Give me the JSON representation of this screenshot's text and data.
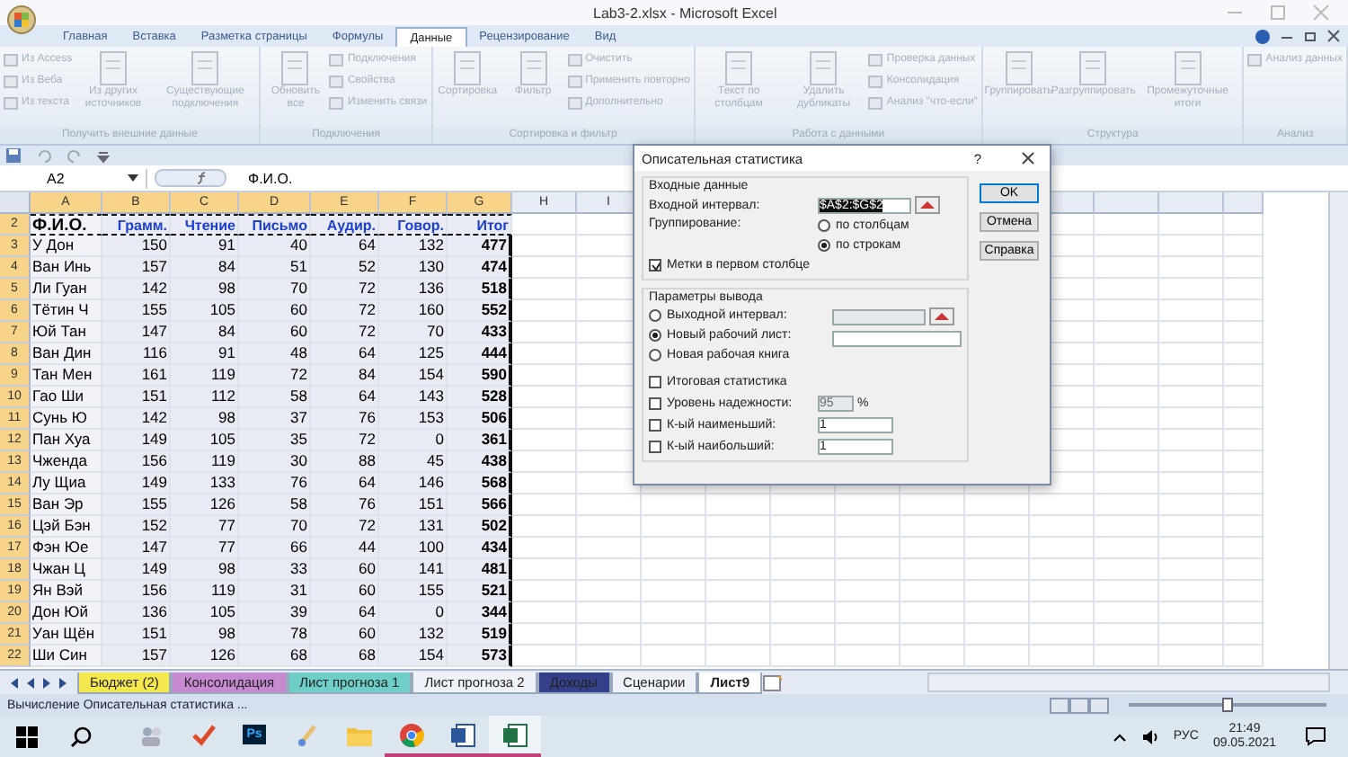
{
  "window": {
    "title": "Lab3-2.xlsx - Microsoft Excel"
  },
  "ribbon": {
    "tabs": [
      {
        "label": "Главная",
        "selected": false
      },
      {
        "label": "Вставка",
        "selected": false
      },
      {
        "label": "Разметка страницы",
        "selected": false
      },
      {
        "label": "Формулы",
        "selected": false
      },
      {
        "label": "Данные",
        "selected": true
      },
      {
        "label": "Рецензирование",
        "selected": false
      },
      {
        "label": "Вид",
        "selected": false
      }
    ],
    "groups": [
      {
        "label": "Получить внешние данные",
        "items": [
          {
            "kind": "stack",
            "entries": [
              "Из Access",
              "Из Веба",
              "Из текста"
            ]
          },
          {
            "kind": "large",
            "label": "Из других источников"
          },
          {
            "kind": "large",
            "label": "Существующие подключения"
          }
        ]
      },
      {
        "label": "Подключения",
        "items": [
          {
            "kind": "large",
            "label": "Обновить все"
          },
          {
            "kind": "stack",
            "entries": [
              "Подключения",
              "Свойства",
              "Изменить связи"
            ]
          }
        ]
      },
      {
        "label": "Сортировка и фильтр",
        "items": [
          {
            "kind": "large",
            "label": "Сортировка"
          },
          {
            "kind": "large",
            "label": "Фильтр"
          },
          {
            "kind": "stack",
            "entries": [
              "Очистить",
              "Применить повторно",
              "Дополнительно"
            ]
          }
        ]
      },
      {
        "label": "Работа с данными",
        "items": [
          {
            "kind": "large",
            "label": "Текст по столбцам"
          },
          {
            "kind": "large",
            "label": "Удалить дубликаты"
          },
          {
            "kind": "stack",
            "entries": [
              "Проверка данных",
              "Консолидация",
              "Анализ \"что-если\""
            ]
          }
        ]
      },
      {
        "label": "Структура",
        "items": [
          {
            "kind": "large",
            "label": "Группировать"
          },
          {
            "kind": "large",
            "label": "Разгруппировать"
          },
          {
            "kind": "large",
            "label": "Промежуточные итоги"
          }
        ]
      },
      {
        "label": "Анализ",
        "items": [
          {
            "kind": "stack",
            "entries": [
              "Анализ данных"
            ]
          }
        ]
      }
    ]
  },
  "formula_bar": {
    "name_box": "A2",
    "formula": "Ф.И.О."
  },
  "sheet": {
    "columns": [
      "A",
      "B",
      "C",
      "D",
      "E",
      "F",
      "G",
      "H",
      "I"
    ],
    "header_row": {
      "number": "2",
      "cells": [
        "Ф.И.О.",
        "Грамм.",
        "Чтение",
        "Письмо",
        "Аудир.",
        "Говор.",
        "Итог"
      ]
    },
    "rows": [
      {
        "number": "3",
        "name": "У Дон",
        "values": [
          "150",
          "91",
          "40",
          "64",
          "132"
        ],
        "total": "477"
      },
      {
        "number": "4",
        "name": "Ван Инь",
        "values": [
          "157",
          "84",
          "51",
          "52",
          "130"
        ],
        "total": "474"
      },
      {
        "number": "5",
        "name": "Ли Гуан",
        "values": [
          "142",
          "98",
          "70",
          "72",
          "136"
        ],
        "total": "518"
      },
      {
        "number": "6",
        "name": "Тётин Ч",
        "values": [
          "155",
          "105",
          "60",
          "72",
          "160"
        ],
        "total": "552"
      },
      {
        "number": "7",
        "name": "Юй Тан",
        "values": [
          "147",
          "84",
          "60",
          "72",
          "70"
        ],
        "total": "433"
      },
      {
        "number": "8",
        "name": "Ван Дин",
        "values": [
          "116",
          "91",
          "48",
          "64",
          "125"
        ],
        "total": "444"
      },
      {
        "number": "9",
        "name": "Тан Мен",
        "values": [
          "161",
          "119",
          "72",
          "84",
          "154"
        ],
        "total": "590"
      },
      {
        "number": "10",
        "name": "Гао Ши",
        "values": [
          "151",
          "112",
          "58",
          "64",
          "143"
        ],
        "total": "528"
      },
      {
        "number": "11",
        "name": "Сунь Ю",
        "values": [
          "142",
          "98",
          "37",
          "76",
          "153"
        ],
        "total": "506"
      },
      {
        "number": "12",
        "name": "Пан Хуа",
        "values": [
          "149",
          "105",
          "35",
          "72",
          "0"
        ],
        "total": "361"
      },
      {
        "number": "13",
        "name": "Чженда",
        "values": [
          "156",
          "119",
          "30",
          "88",
          "45"
        ],
        "total": "438"
      },
      {
        "number": "14",
        "name": "Лу Щиа",
        "values": [
          "149",
          "133",
          "76",
          "64",
          "146"
        ],
        "total": "568"
      },
      {
        "number": "15",
        "name": "Ван Эр",
        "values": [
          "155",
          "126",
          "58",
          "76",
          "151"
        ],
        "total": "566"
      },
      {
        "number": "16",
        "name": "Цэй Бэн",
        "values": [
          "152",
          "77",
          "70",
          "72",
          "131"
        ],
        "total": "502"
      },
      {
        "number": "17",
        "name": "Фэн Юе",
        "values": [
          "147",
          "77",
          "66",
          "44",
          "100"
        ],
        "total": "434"
      },
      {
        "number": "18",
        "name": "Чжан Ц",
        "values": [
          "149",
          "98",
          "33",
          "60",
          "141"
        ],
        "total": "481"
      },
      {
        "number": "19",
        "name": "Ян Вэй",
        "values": [
          "156",
          "119",
          "31",
          "60",
          "155"
        ],
        "total": "521"
      },
      {
        "number": "20",
        "name": "Дон Юй",
        "values": [
          "136",
          "105",
          "39",
          "64",
          "0"
        ],
        "total": "344"
      },
      {
        "number": "21",
        "name": "Уан Щён",
        "values": [
          "151",
          "98",
          "78",
          "60",
          "132"
        ],
        "total": "519"
      },
      {
        "number": "22",
        "name": "Ши Син",
        "values": [
          "157",
          "126",
          "68",
          "68",
          "154"
        ],
        "total": "573"
      }
    ]
  },
  "dialog": {
    "title": "Описательная статистика",
    "help": "?",
    "input_section": "Входные данные",
    "input_range_label": "Входной интервал:",
    "input_range": "$A$2:$G$2",
    "grouping_label": "Группирование:",
    "grouping": [
      {
        "label": "по столбцам",
        "selected": false
      },
      {
        "label": "по строкам",
        "selected": true
      }
    ],
    "labels_checkbox": {
      "label": "Метки в первом столбце",
      "checked": true
    },
    "output_section": "Параметры вывода",
    "output": [
      {
        "label": "Выходной интервал:",
        "selected": false,
        "kind": "range"
      },
      {
        "label": "Новый рабочий лист:",
        "selected": true,
        "kind": "text"
      },
      {
        "label": "Новая рабочая книга",
        "selected": false,
        "kind": "none"
      }
    ],
    "options": [
      {
        "label": "Итоговая статистика",
        "checked": false
      },
      {
        "label": "Уровень надежности:",
        "checked": false,
        "value": "95",
        "unit": "%",
        "disabled": true
      },
      {
        "label": "К-ый наименьший:",
        "checked": false,
        "value": "1",
        "disabled": false
      },
      {
        "label": "К-ый наибольший:",
        "checked": false,
        "value": "1",
        "disabled": false
      }
    ],
    "buttons": [
      "OK",
      "Отмена",
      "Справка"
    ]
  },
  "sheet_tabs": [
    {
      "label": "Бюджет (2)",
      "color": "#f3e84e",
      "selected": false
    },
    {
      "label": "Консолидация",
      "color": "#c58ad0",
      "selected": false
    },
    {
      "label": "Лист прогноза 1",
      "color": "#6fcfc8",
      "selected": false
    },
    {
      "label": "Лист прогноза 2",
      "selected": false
    },
    {
      "label": "Доходы",
      "color": "#34418a",
      "selected": false
    },
    {
      "label": "Сценарии",
      "selected": false
    },
    {
      "label": "Лист9",
      "selected": true
    }
  ],
  "status_bar": {
    "text": "Вычисление Описательная статистика ...",
    "zoom": {
      "level": 0.5
    }
  },
  "taskbar": {
    "apps": [
      {
        "kind": "people",
        "running": false,
        "selected": false
      },
      {
        "kind": "check",
        "running": false,
        "selected": false
      },
      {
        "kind": "photoshop",
        "label": "Ps",
        "running": false,
        "selected": false
      },
      {
        "kind": "brush",
        "running": false,
        "selected": false
      },
      {
        "kind": "folder",
        "running": false,
        "selected": false
      },
      {
        "kind": "chrome",
        "running": true,
        "selected": false
      },
      {
        "kind": "word",
        "running": true,
        "selected": false
      },
      {
        "kind": "excel",
        "running": true,
        "selected": true
      }
    ],
    "language": "РУС",
    "time": "21:49",
    "date": "09.05.2021"
  }
}
